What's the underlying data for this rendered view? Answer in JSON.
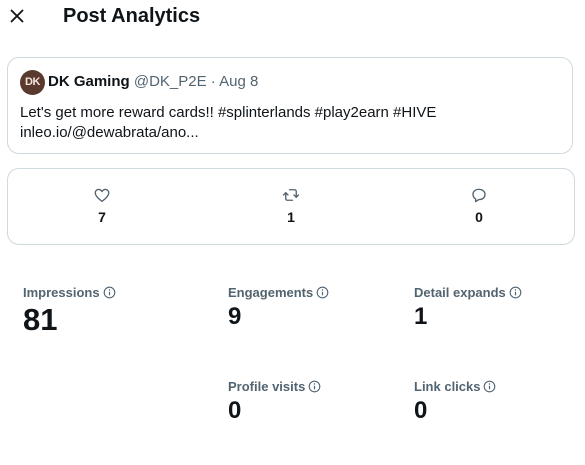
{
  "header": {
    "title": "Post Analytics"
  },
  "tweet": {
    "avatar_initials": "DK",
    "display_name": "DK Gaming",
    "handle": "@DK_P2E",
    "separator": "·",
    "date": "Aug 8",
    "line1": "Let's get more reward cards!! #splinterlands #play2earn #HIVE",
    "line2": "inleo.io/@dewabrata/ano..."
  },
  "engagement": {
    "likes": "7",
    "reposts": "1",
    "replies": "0"
  },
  "stats": {
    "impressions": {
      "label": "Impressions",
      "value": "81"
    },
    "engagements": {
      "label": "Engagements",
      "value": "9"
    },
    "detail_expands": {
      "label": "Detail expands",
      "value": "1"
    },
    "profile_visits": {
      "label": "Profile visits",
      "value": "0"
    },
    "link_clicks": {
      "label": "Link clicks",
      "value": "0"
    }
  },
  "colors": {
    "text_primary": "#0f1419",
    "text_secondary": "#536471",
    "border": "#cfd9de",
    "avatar_bg": "#5a3a2e"
  },
  "icons": [
    "close-icon",
    "heart-icon",
    "repost-icon",
    "reply-icon",
    "info-icon"
  ]
}
